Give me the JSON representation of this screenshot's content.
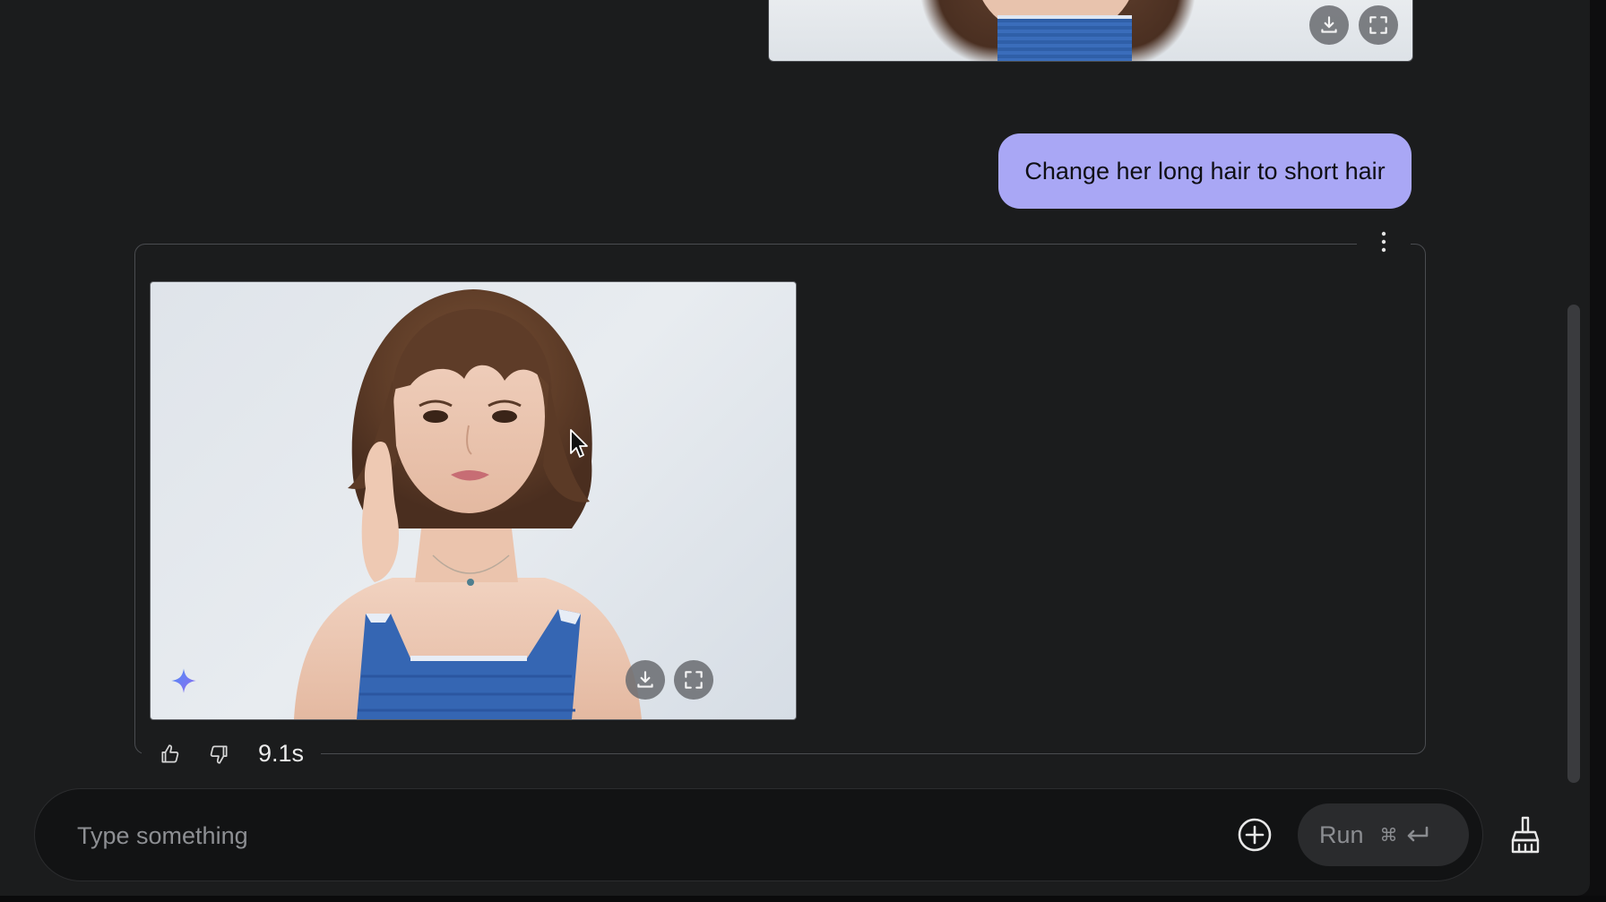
{
  "conversation": {
    "user_message": "Change her long hair to short hair",
    "response": {
      "elapsed": "9.1s"
    }
  },
  "input": {
    "placeholder": "Type something",
    "value": ""
  },
  "run_button": {
    "label": "Run",
    "shortcut": "⌘"
  },
  "icons": {
    "download": "download-icon",
    "fullscreen": "fullscreen-icon",
    "more": "more-vert-icon",
    "like": "thumb-up-icon",
    "dislike": "thumb-down-icon",
    "add": "add-circle-icon",
    "enter": "enter-key-icon",
    "clear": "broom-icon",
    "sparkle": "gemini-sparkle-icon"
  },
  "colors": {
    "background": "#1b1c1d",
    "user_bubble": "#a9a7f5",
    "border": "#4a4c50",
    "run_button_bg": "#2a2b2d"
  }
}
